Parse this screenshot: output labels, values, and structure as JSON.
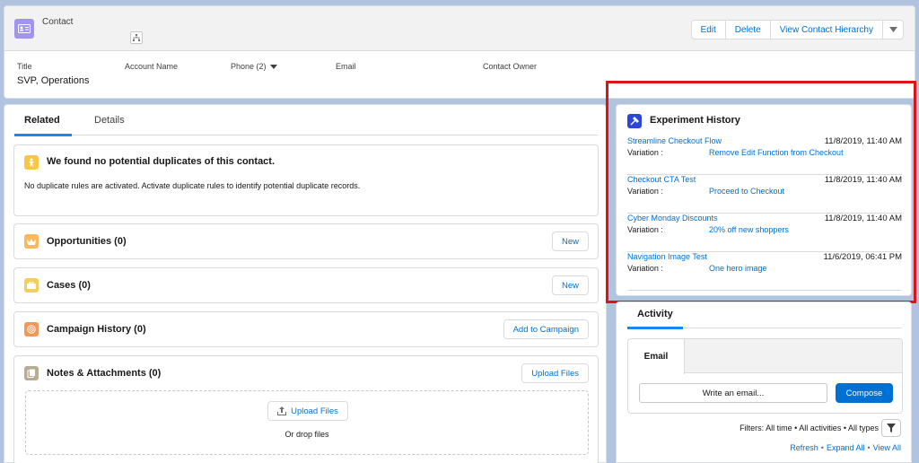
{
  "header": {
    "object_label": "Contact",
    "buttons": [
      "Edit",
      "Delete",
      "View Contact Hierarchy"
    ],
    "fields": [
      {
        "label": "Title",
        "value": "SVP, Operations"
      },
      {
        "label": "Account Name",
        "value": ""
      },
      {
        "label": "Phone (2)",
        "value": ""
      },
      {
        "label": "Email",
        "value": ""
      },
      {
        "label": "Contact Owner",
        "value": ""
      }
    ]
  },
  "tabs": {
    "related": "Related",
    "details": "Details"
  },
  "duplicates": {
    "title": "We found no potential duplicates of this contact.",
    "message": "No duplicate rules are activated. Activate duplicate rules to identify potential duplicate records."
  },
  "related_lists": {
    "opportunities": {
      "title": "Opportunities (0)",
      "button": "New"
    },
    "cases": {
      "title": "Cases (0)",
      "button": "New"
    },
    "campaign_history": {
      "title": "Campaign History (0)",
      "button": "Add to Campaign"
    },
    "notes": {
      "title": "Notes & Attachments (0)",
      "button": "Upload Files",
      "upload_label": "Upload Files",
      "drop_text": "Or drop files"
    }
  },
  "experiment_history": {
    "title": "Experiment History",
    "variation_label": "Variation :",
    "items": [
      {
        "name": "Streamline Checkout Flow",
        "date": "11/8/2019, 11:40 AM",
        "variation": "Remove Edit Function from Checkout"
      },
      {
        "name": "Checkout CTA Test",
        "date": "11/8/2019, 11:40 AM",
        "variation": "Proceed to Checkout"
      },
      {
        "name": "Cyber Monday Discounts",
        "date": "11/8/2019, 11:40 AM",
        "variation": "20% off new shoppers"
      },
      {
        "name": "Navigation Image Test",
        "date": "11/6/2019, 06:41 PM",
        "variation": "One hero image"
      }
    ]
  },
  "activity": {
    "tab": "Activity",
    "email_tab": "Email",
    "write_placeholder": "Write an email...",
    "compose": "Compose",
    "filters": "Filters: All time • All activities • All types",
    "links": {
      "refresh": "Refresh",
      "expand": "Expand All",
      "view": "View All"
    }
  },
  "colors": {
    "brand_blue": "#0070d2",
    "highlight_red": "#d9141b",
    "contact_icon": "#a094ed",
    "experiment_icon": "#2a48d4",
    "duplicates_icon": "#f9c647",
    "opportunities_icon": "#fcb95b",
    "cases_icon": "#f2cf5b",
    "campaign_icon": "#f49756",
    "notes_icon": "#baac93",
    "page_background": "#b0c4df"
  }
}
